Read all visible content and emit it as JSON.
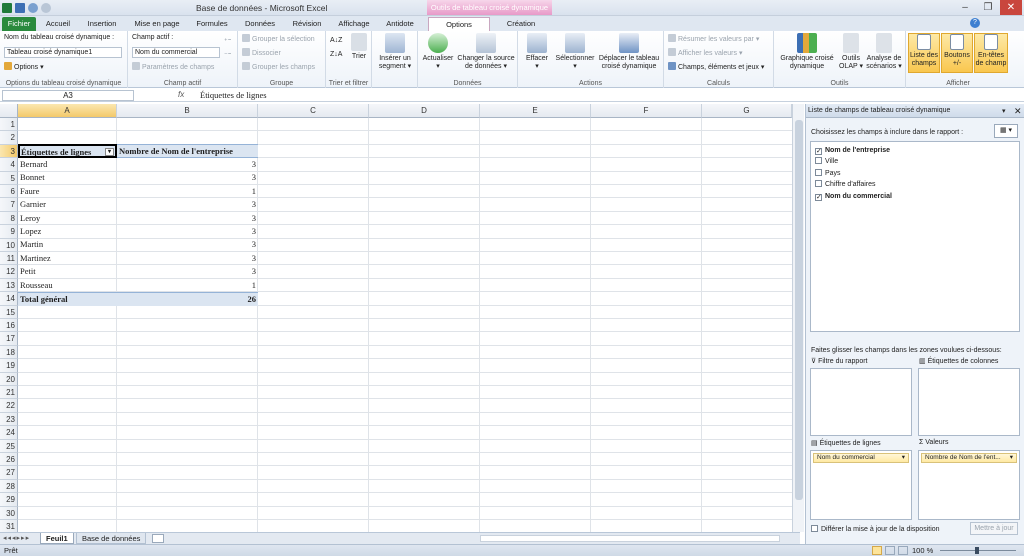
{
  "window": {
    "title": "Base de données - Microsoft Excel",
    "context_tools": "Outils de tableau croisé dynamique"
  },
  "tabs": [
    "Fichier",
    "Accueil",
    "Insertion",
    "Mise en page",
    "Formules",
    "Données",
    "Révision",
    "Affichage",
    "Antidote",
    "Options",
    "Création"
  ],
  "ribbon": {
    "pt_options": {
      "name_label": "Nom du tableau croisé dynamique :",
      "name_value": "Tableau croisé dynamique1",
      "options_btn": "Options",
      "group": "Options du tableau croisé dynamique"
    },
    "active_field": {
      "label": "Champ actif :",
      "value": "Nom du commercial",
      "settings": "Paramètres de champs",
      "group": "Champ actif"
    },
    "group_grp": {
      "select": "Grouper la sélection",
      "ungroup": "Dissocier",
      "group_fields": "Grouper les champs",
      "group": "Groupe"
    },
    "sort": {
      "sort_btn": "Trier",
      "group": "Trier et filtrer"
    },
    "segment": {
      "line1": "Insérer un",
      "line2": "segment"
    },
    "data": {
      "refresh": "Actualiser",
      "change_source_1": "Changer la source",
      "change_source_2": "de données",
      "group": "Données"
    },
    "actions": {
      "clear": "Effacer",
      "select": "Sélectionner",
      "move_1": "Déplacer le tableau",
      "move_2": "croisé dynamique",
      "group": "Actions"
    },
    "calc": {
      "summarize": "Résumer les valeurs par",
      "show_values": "Afficher les valeurs",
      "fields_items": "Champs, éléments et jeux",
      "group": "Calculs"
    },
    "tools": {
      "chart_1": "Graphique croisé",
      "chart_2": "dynamique",
      "olap_1": "Outils",
      "olap_2": "OLAP",
      "whatif_1": "Analyse de",
      "whatif_2": "scénarios",
      "group": "Outils"
    },
    "show": {
      "field_list_1": "Liste des",
      "field_list_2": "champs",
      "buttons_1": "Boutons",
      "buttons_2": "+/-",
      "headers_1": "En-têtes",
      "headers_2": "de champ",
      "group": "Afficher"
    }
  },
  "formula": {
    "name_box": "A3",
    "fx": "fx",
    "content": "Étiquettes de lignes"
  },
  "columns": [
    "A",
    "B",
    "C",
    "D",
    "E",
    "F",
    "G"
  ],
  "rows": [
    "1",
    "2",
    "3",
    "4",
    "5",
    "6",
    "7",
    "8",
    "9",
    "10",
    "11",
    "12",
    "13",
    "14",
    "15",
    "16",
    "17",
    "18",
    "19",
    "20",
    "21",
    "22",
    "23",
    "24",
    "25",
    "26",
    "27",
    "28",
    "29",
    "30",
    "31"
  ],
  "pivot": {
    "header_a": "Étiquettes de lignes",
    "header_b": "Nombre de Nom de l'entreprise",
    "data": [
      {
        "name": "Bernard",
        "count": "3"
      },
      {
        "name": "Bonnet",
        "count": "3"
      },
      {
        "name": "Faure",
        "count": "1"
      },
      {
        "name": "Garnier",
        "count": "3"
      },
      {
        "name": "Leroy",
        "count": "3"
      },
      {
        "name": "Lopez",
        "count": "3"
      },
      {
        "name": "Martin",
        "count": "3"
      },
      {
        "name": "Martinez",
        "count": "3"
      },
      {
        "name": "Petit",
        "count": "3"
      },
      {
        "name": "Rousseau",
        "count": "1"
      }
    ],
    "total_label": "Total général",
    "total_value": "26"
  },
  "sheets": [
    "Feuil1",
    "Base de données"
  ],
  "status": {
    "ready": "Prêt",
    "zoom": "100 %"
  },
  "pane": {
    "title": "Liste de champs de tableau croisé dynamique",
    "choose": "Choisissez les champs à inclure dans le rapport :",
    "fields": [
      {
        "label": "Nom de l'entreprise",
        "checked": "✓"
      },
      {
        "label": "Ville",
        "checked": ""
      },
      {
        "label": "Pays",
        "checked": ""
      },
      {
        "label": "Chiffre d'affaires",
        "checked": ""
      },
      {
        "label": "Nom du commercial",
        "checked": "✓"
      }
    ],
    "drag": "Faites glisser les champs dans les zones voulues ci-dessous:",
    "filter": "Filtre du rapport",
    "columns": "Étiquettes de colonnes",
    "rows_area": "Étiquettes de lignes",
    "values": "Valeurs",
    "row_chip": "Nom du commercial",
    "value_chip": "Nombre de Nom de l'ent...",
    "defer": "Différer la mise à jour de la disposition",
    "update": "Mettre à jour"
  },
  "colors": {
    "file_tab": "#2a8a3d",
    "context": "#e89ac8",
    "selected_header": "#f9d77e"
  }
}
